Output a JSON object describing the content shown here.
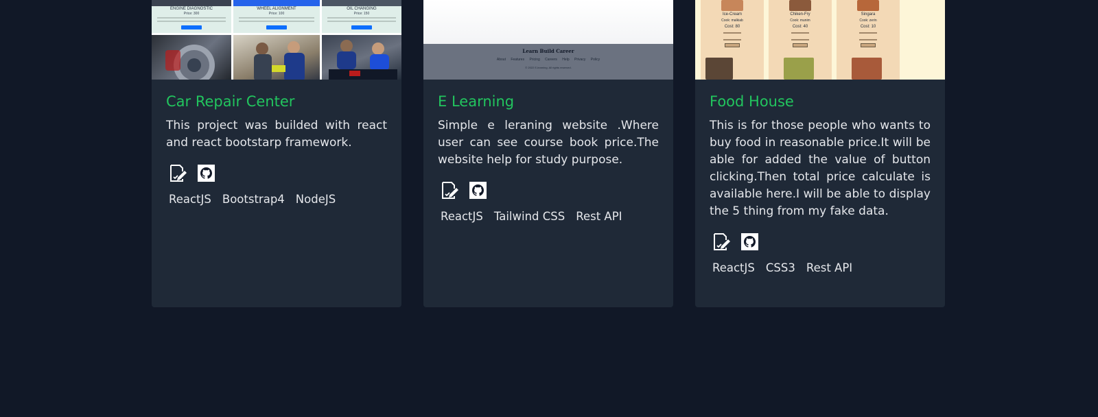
{
  "projects": [
    {
      "title": "Car Repair Center",
      "description": "This project was builded with react and react bootstarp framework.",
      "tags": [
        "ReactJS",
        "Bootstrap4",
        "NodeJS"
      ],
      "thumbnail": {
        "services": [
          {
            "name": "ENGINE DIAGNOSTIC",
            "price": "Price: 300"
          },
          {
            "name": "WHEEL ALIGNMENT",
            "price": "Price: 100"
          },
          {
            "name": "OIL CHANGING",
            "price": "Price: 150"
          }
        ]
      }
    },
    {
      "title": "E Learning",
      "description": "Simple e leraning website .Where user can see course book price.The website help for study purpose.",
      "tags": [
        "ReactJS",
        "Tailwind CSS",
        "Rest API"
      ],
      "thumbnail": {
        "brand": "Learn Build Career",
        "links": "About Features Pricing Careers Help Privacy Policy",
        "copyright": "© 2022 E-learning. All rights reserved."
      }
    },
    {
      "title": "Food House",
      "description": "This is for those people who wants to buy food in reasonable price.It will be able for added the value of button clicking.Then total price calculate is available here.I will be able to display the 5 thing from my fake data.",
      "tags": [
        "ReactJS",
        "CSS3",
        "Rest API"
      ],
      "thumbnail": {
        "items": [
          {
            "name": "Ice-Cream",
            "cook": "Cook: malkiab",
            "cost": "Cost: 80"
          },
          {
            "name": "Chiken-Fry",
            "cook": "Cook: munim",
            "cost": "Cost: 40"
          },
          {
            "name": "Singara",
            "cook": "Cook: zerin",
            "cost": "Cost: 10"
          }
        ]
      }
    }
  ],
  "icons": {
    "live": "edit-document-icon",
    "code": "github-icon"
  },
  "colors": {
    "page_bg": "#111827",
    "card_bg": "#1f2937",
    "title": "#22c55e",
    "text": "#e5e7eb"
  }
}
